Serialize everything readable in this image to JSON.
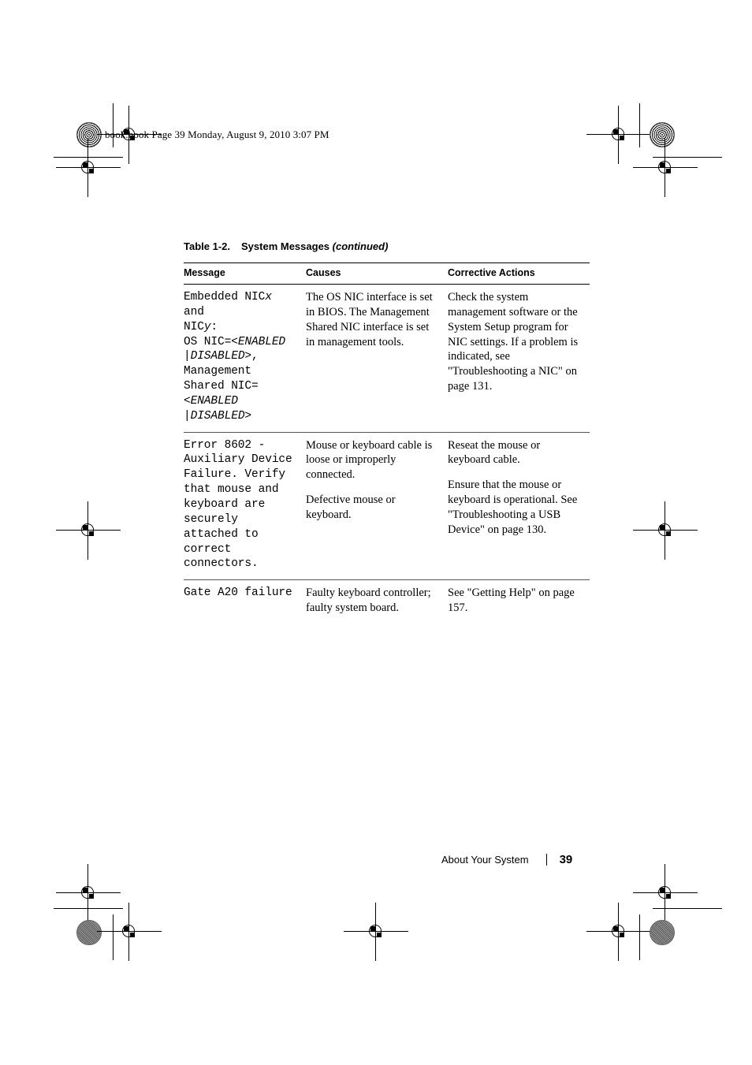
{
  "page": {
    "slug": "book.book  Page 39  Monday, August 9, 2010  3:07 PM",
    "footer_section": "About Your System",
    "footer_page_number": "39"
  },
  "table": {
    "caption_number": "Table 1-2.",
    "caption_title": "System Messages",
    "caption_continued": "(continued)",
    "headers": [
      "Message",
      "Causes",
      "Corrective Actions"
    ],
    "rows": [
      {
        "message_line1": "Embedded NIC",
        "message_var1": "x",
        "message_line1b": " and",
        "message_line2": "NIC",
        "message_var2": "y",
        "message_line2b": ":",
        "message_line3": "OS NIC=<",
        "message_em3": "ENABLED",
        "message_line4pipe": "|",
        "message_em4": "DISABLED",
        "message_line4b": ">,",
        "message_line5": "Management",
        "message_line6": "Shared NIC=",
        "message_line7lt": "<",
        "message_em7": "ENABLED",
        "message_line8pipe": "|",
        "message_em8": "DISABLED",
        "message_line8gt": ">",
        "causes": [
          "The OS NIC interface is set in BIOS. The Management Shared NIC interface is set in management tools."
        ],
        "actions": [
          "Check the system management software or the System Setup program for NIC settings. If a problem is indicated, see \"Troubleshooting a NIC\" on page 131."
        ]
      },
      {
        "message": "Error 8602 - Auxiliary Device Failure. Verify that mouse and keyboard are securely attached to correct connectors.",
        "causes": [
          "Mouse or keyboard cable is loose or improperly connected.",
          "Defective mouse or keyboard."
        ],
        "actions": [
          "Reseat the mouse or keyboard cable.",
          "Ensure that the mouse or keyboard is operational. See \"Troubleshooting a USB Device\" on page 130."
        ]
      },
      {
        "message": "Gate A20 failure",
        "causes": [
          "Faulty keyboard controller; faulty system board."
        ],
        "actions": [
          "See \"Getting Help\" on page 157."
        ]
      }
    ]
  }
}
